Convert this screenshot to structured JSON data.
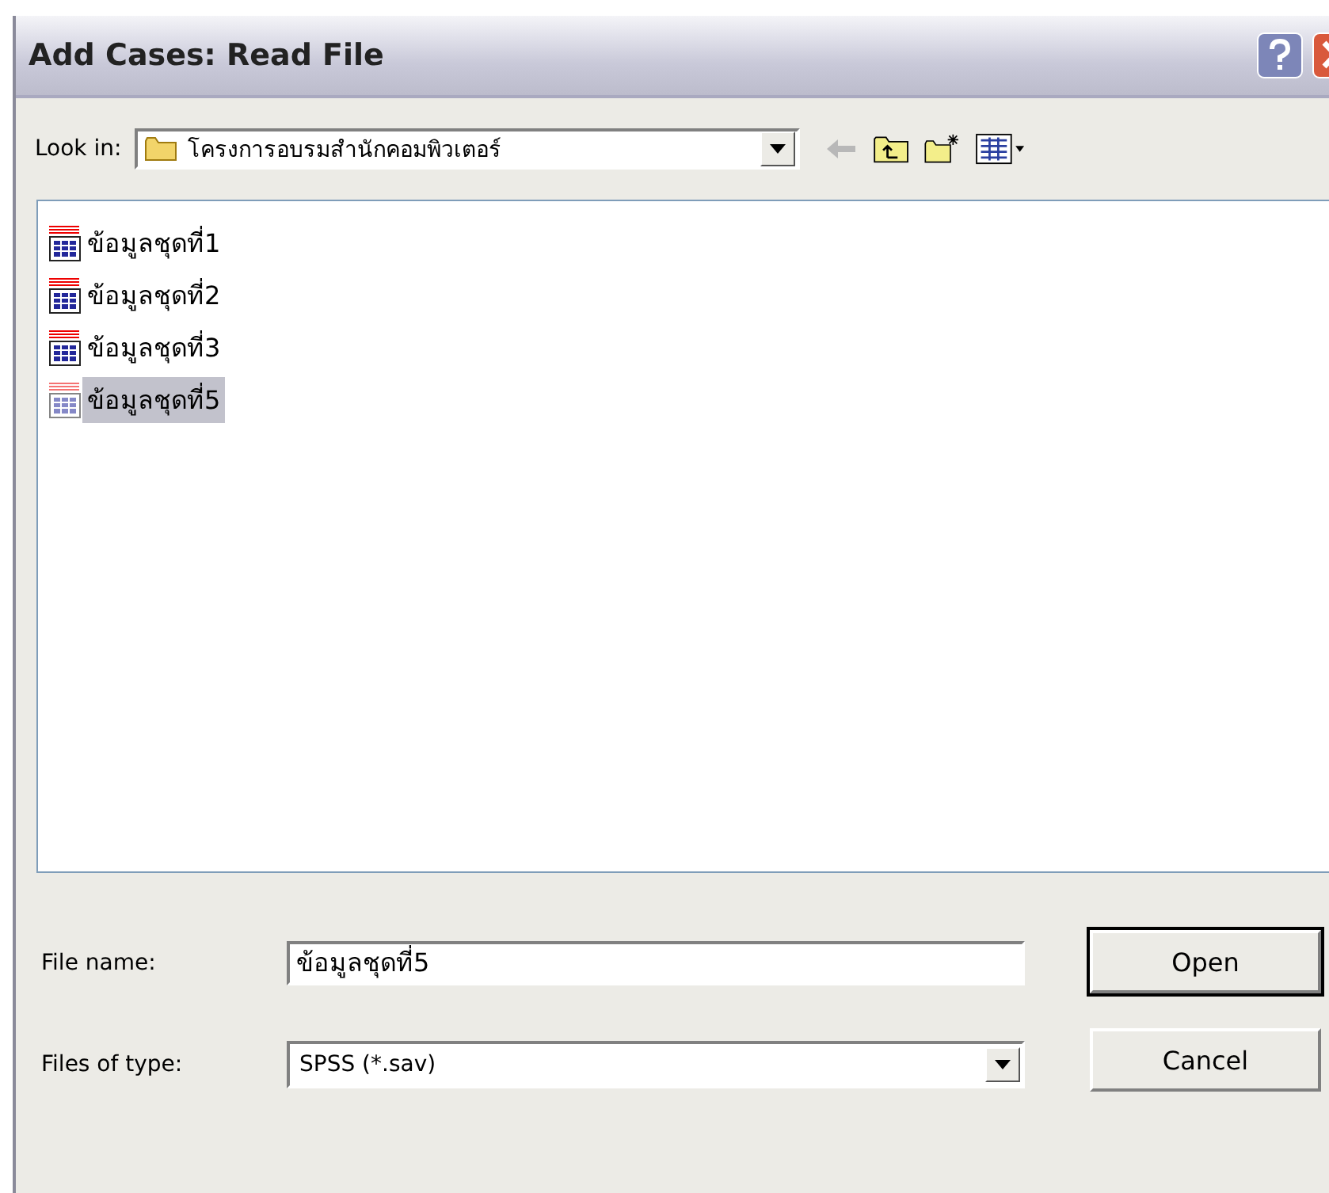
{
  "window": {
    "title": "Add Cases: Read File"
  },
  "look_in": {
    "label": "Look in:",
    "value": "โครงการอบรมสำนักคอมพิวเตอร์"
  },
  "files": [
    {
      "name": "ข้อมูลชุดที่1",
      "selected": false
    },
    {
      "name": "ข้อมูลชุดที่2",
      "selected": false
    },
    {
      "name": "ข้อมูลชุดที่3",
      "selected": false
    },
    {
      "name": "ข้อมูลชุดที่5",
      "selected": true
    }
  ],
  "file_name": {
    "label": "File name:",
    "value": "ข้อมูลชุดที่5"
  },
  "file_type": {
    "label": "Files of type:",
    "value": "SPSS (*.sav)"
  },
  "buttons": [
    "Open",
    "Cancel"
  ]
}
